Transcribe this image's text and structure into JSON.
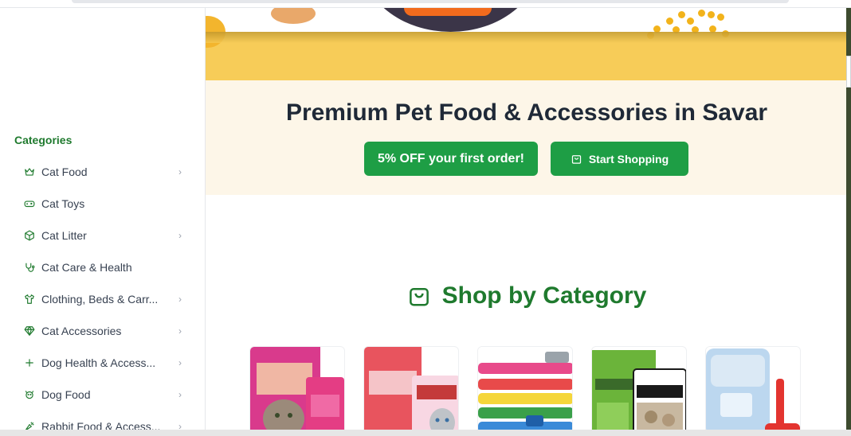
{
  "sidebar": {
    "title": "Categories",
    "items": [
      {
        "label": "Cat Food",
        "icon": "crown-icon",
        "has_submenu": true
      },
      {
        "label": "Cat Toys",
        "icon": "gamepad-icon",
        "has_submenu": false
      },
      {
        "label": "Cat Litter",
        "icon": "box-icon",
        "has_submenu": true
      },
      {
        "label": "Cat Care & Health",
        "icon": "stethoscope-icon",
        "has_submenu": false
      },
      {
        "label": "Clothing, Beds & Carr...",
        "icon": "shirt-icon",
        "has_submenu": true
      },
      {
        "label": "Cat Accessories",
        "icon": "gem-icon",
        "has_submenu": true
      },
      {
        "label": "Dog Health & Access...",
        "icon": "plus-icon",
        "has_submenu": true
      },
      {
        "label": "Dog Food",
        "icon": "dog-icon",
        "has_submenu": true
      },
      {
        "label": "Rabbit Food & Access...",
        "icon": "carrot-icon",
        "has_submenu": true
      }
    ]
  },
  "promo": {
    "headline": "Premium Pet Food & Accessories in Savar",
    "offer_button": "5% OFF your first order!",
    "shop_button": "Start Shopping"
  },
  "section": {
    "title": "Shop by Category"
  },
  "categories": [
    {
      "image": "cat-food-packs"
    },
    {
      "image": "cat-treat-packs"
    },
    {
      "image": "dog-collars"
    },
    {
      "image": "cat-litter-bags"
    },
    {
      "image": "litter-box-scoop"
    }
  ],
  "colors": {
    "accent_green": "#1f7a2e",
    "button_green": "#1e9e45",
    "hero_yellow": "#f7cc58",
    "promo_bg": "#fdf6e8"
  }
}
